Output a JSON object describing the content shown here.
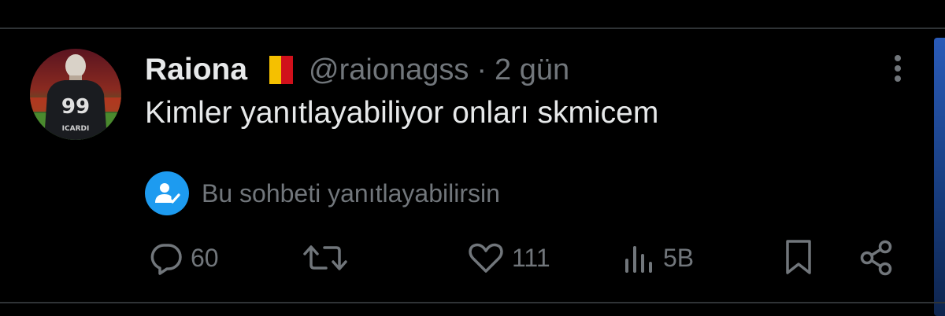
{
  "tweet": {
    "display_name": "Raiona",
    "flag_colors": [
      "#f5c000",
      "#d0101b"
    ],
    "handle": "@raionagss",
    "separator": "·",
    "time": "2 gün",
    "text": "Kimler yanıtlayabiliyor onları skmicem",
    "avatar": {
      "jersey_number": "99",
      "jersey_name": "ICARDI"
    }
  },
  "reply_notice": {
    "text": "Bu sohbeti yanıtlayabilirsin",
    "icon": "person-check-icon",
    "color": "#1d9bf0"
  },
  "actions": {
    "reply_count": "60",
    "retweet_count": "",
    "like_count": "111",
    "views_count": "5B"
  },
  "colors": {
    "background": "#000000",
    "text_primary": "#e7e9ea",
    "text_secondary": "#71767b",
    "accent": "#1d9bf0",
    "divider": "#2f3336"
  }
}
